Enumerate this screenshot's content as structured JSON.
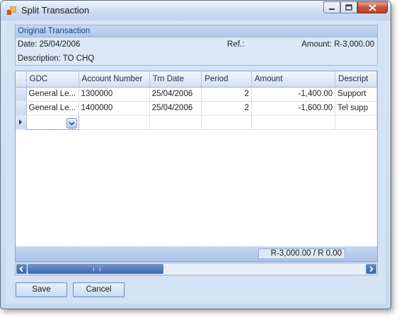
{
  "window": {
    "title": "Split Transaction",
    "icon": "app-icon"
  },
  "original": {
    "header": "Original Transaction",
    "date": "Date: 25/04/2006",
    "ref": "Ref.:",
    "amount": "Amount: R-3,000.00",
    "description": "Description: TO CHQ"
  },
  "grid": {
    "columns": [
      "GDC",
      "Account Number",
      "Trn Date",
      "Period",
      "Amount",
      "Descript"
    ],
    "rows": [
      [
        "General Le...",
        "1300000",
        "25/04/2006",
        "2",
        "-1,400.00",
        "Support"
      ],
      [
        "General Le...",
        "1400000",
        "25/04/2006",
        "2",
        "-1,600.00",
        "Tel supp"
      ]
    ],
    "total": "R-3,000.00 / R 0.00"
  },
  "buttons": {
    "save": "Save",
    "cancel": "Cancel"
  }
}
